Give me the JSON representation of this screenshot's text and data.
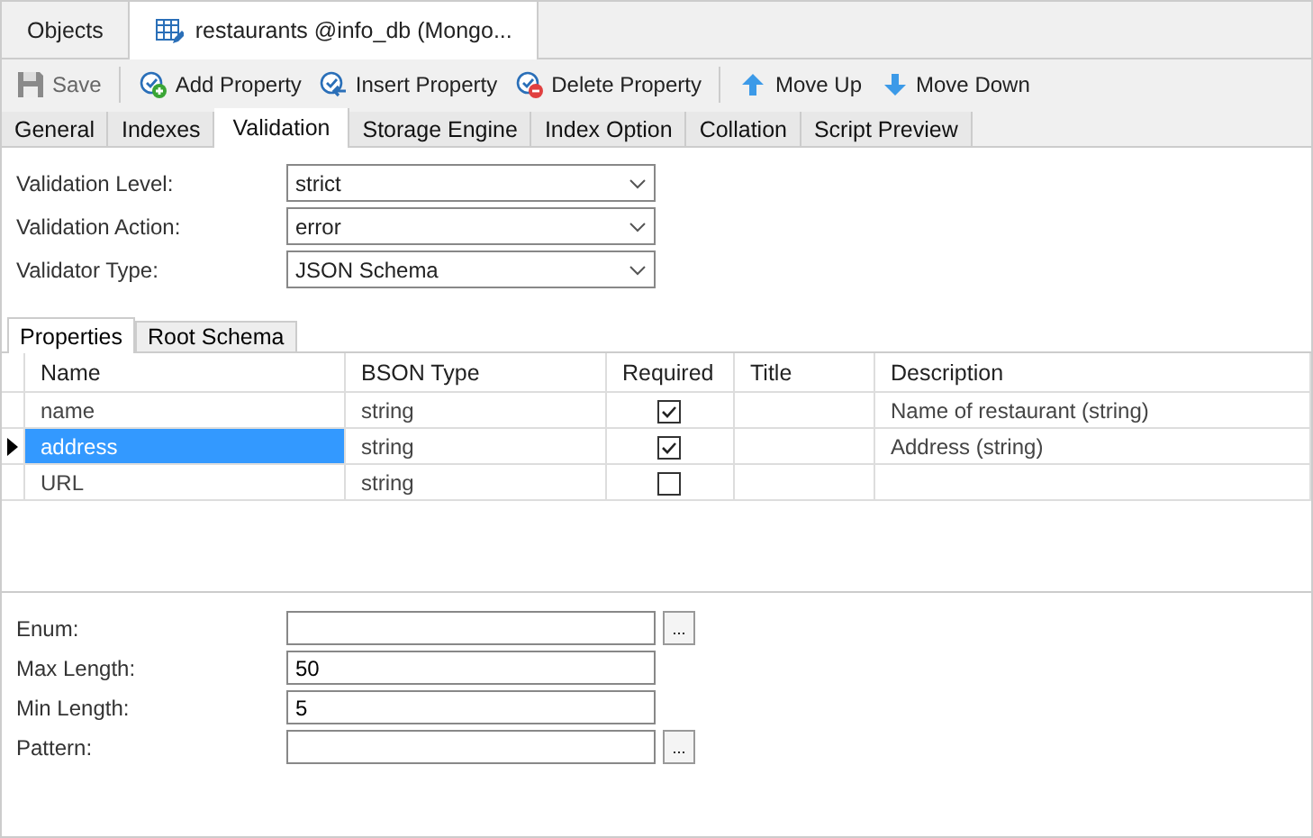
{
  "doc_tabs": [
    {
      "label": "Objects",
      "icon": false,
      "selected": false
    },
    {
      "label": "restaurants @info_db (Mongo...",
      "icon": true,
      "selected": true
    }
  ],
  "toolbar": [
    {
      "label": "Save",
      "kind": "save",
      "disabled": true
    },
    {
      "label": "Add Property",
      "kind": "add",
      "disabled": false
    },
    {
      "label": "Insert Property",
      "kind": "insert",
      "disabled": false
    },
    {
      "label": "Delete Property",
      "kind": "delete",
      "disabled": false
    },
    {
      "label": "Move Up",
      "kind": "up",
      "disabled": false
    },
    {
      "label": "Move Down",
      "kind": "down",
      "disabled": false
    }
  ],
  "tabs": [
    {
      "label": "General",
      "selected": false
    },
    {
      "label": "Indexes",
      "selected": false
    },
    {
      "label": "Validation",
      "selected": true
    },
    {
      "label": "Storage Engine",
      "selected": false
    },
    {
      "label": "Index Option",
      "selected": false
    },
    {
      "label": "Collation",
      "selected": false
    },
    {
      "label": "Script Preview",
      "selected": false
    }
  ],
  "settings": [
    {
      "label": "Validation Level:",
      "value": "strict"
    },
    {
      "label": "Validation Action:",
      "value": "error"
    },
    {
      "label": "Validator Type:",
      "value": "JSON Schema"
    }
  ],
  "sub_tabs": [
    {
      "label": "Properties",
      "selected": true
    },
    {
      "label": "Root Schema",
      "selected": false
    }
  ],
  "table": {
    "columns": [
      "Name",
      "BSON Type",
      "Required",
      "Title",
      "Description"
    ],
    "rows": [
      {
        "name": "name",
        "bson_type": "string",
        "required": true,
        "description": "Name of restaurant (string)",
        "selected": false
      },
      {
        "name": "address",
        "bson_type": "string",
        "required": true,
        "description": "Address (string)",
        "selected": true
      },
      {
        "name": "URL",
        "bson_type": "string",
        "required": false,
        "selected": false
      }
    ]
  },
  "details": [
    {
      "label": "Enum:",
      "browse_label": "..."
    },
    {
      "label": "Max Length:",
      "value": "50"
    },
    {
      "label": "Min Length:",
      "value": "5"
    },
    {
      "label": "Pattern:",
      "browse_label": "..."
    }
  ]
}
